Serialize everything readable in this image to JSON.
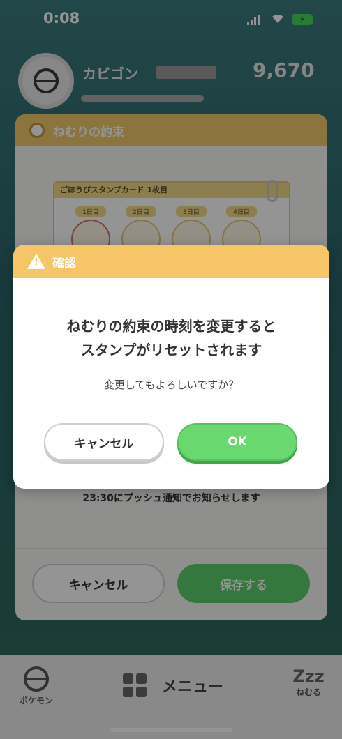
{
  "status_bar": {
    "time": "0:08",
    "battery": "⚡"
  },
  "profile": {
    "name": "カビゴン",
    "score": "9,670"
  },
  "underlying_dialog": {
    "title": "ねむりの約束",
    "stamp_card_title": "ごほうびスタンプカード 1枚目",
    "stamp_days": [
      "1日目",
      "2日目",
      "3日目",
      "4日目"
    ],
    "push_note": "23:30にプッシュ通知でお知らせします",
    "cancel_label": "キャンセル",
    "save_label": "保存する"
  },
  "bottom_nav": {
    "pokemon_label": "ポケモン",
    "menu_label": "メニュー",
    "sleep_label": "ねむる",
    "sleep_icon": "Zzz"
  },
  "modal": {
    "title": "確認",
    "message_line1": "ねむりの約束の時刻を変更すると",
    "message_line2": "スタンプがリセットされます",
    "question": "変更してもよろしいですか？",
    "cancel_label": "キャンセル",
    "ok_label": "OK"
  },
  "colors": {
    "modal_header": "#f5c568",
    "ok_button": "#69d86f"
  },
  "icons": {
    "warning": "warning-triangle-icon"
  }
}
